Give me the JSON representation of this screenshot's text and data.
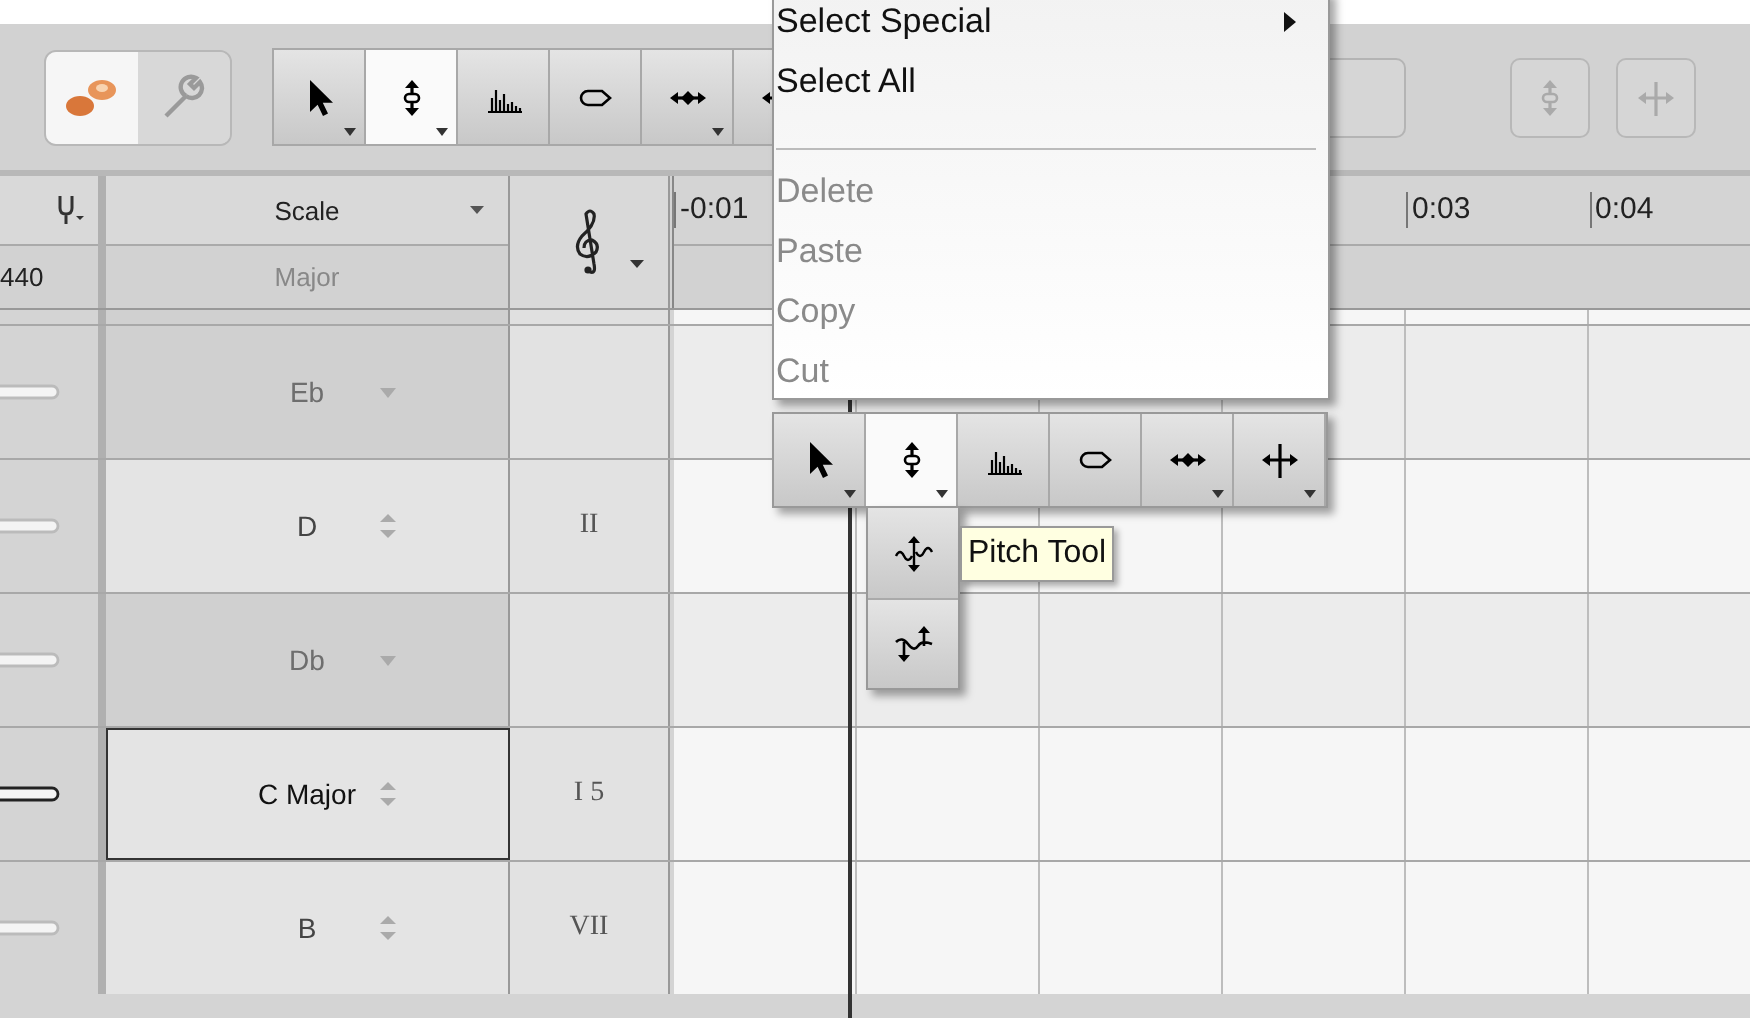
{
  "toolbar": {
    "modes": [
      {
        "selected": true
      },
      {
        "selected": false
      }
    ],
    "tools": [
      {
        "selected": false,
        "has_menu": true
      },
      {
        "selected": true,
        "has_menu": true
      },
      {
        "selected": false,
        "has_menu": false
      },
      {
        "selected": false,
        "has_menu": false
      },
      {
        "selected": false,
        "has_menu": true
      },
      {
        "selected": false
      }
    ]
  },
  "tuning": {
    "value": "440"
  },
  "scale_header": {
    "label": "Scale",
    "value": "Major"
  },
  "timeline": {
    "ticks": [
      {
        "label": "-0:01"
      },
      {
        "label": "0:03"
      },
      {
        "label": "0:04"
      }
    ]
  },
  "rows": [
    {
      "scale": "Eb",
      "enabled": false,
      "selected": false
    },
    {
      "scale": "D",
      "degree": "II",
      "enabled": true,
      "selected": false
    },
    {
      "scale": "Db",
      "enabled": false,
      "selected": false
    },
    {
      "scale": "C Major",
      "degree": "I 5",
      "enabled": true,
      "selected": true
    },
    {
      "scale": "B",
      "degree": "VII",
      "enabled": true,
      "selected": false
    }
  ],
  "context_menu": {
    "items": [
      {
        "kind": "item",
        "label": "Select Special",
        "submenu": true,
        "disabled": false
      },
      {
        "kind": "item",
        "label": "Select All",
        "submenu": false,
        "disabled": false
      },
      {
        "kind": "separator"
      },
      {
        "kind": "item",
        "label": "Delete",
        "submenu": false,
        "disabled": true
      },
      {
        "kind": "item",
        "label": "Paste",
        "submenu": false,
        "disabled": true
      },
      {
        "kind": "item",
        "label": "Copy",
        "submenu": false,
        "disabled": true
      },
      {
        "kind": "item",
        "label": "Cut",
        "submenu": false,
        "disabled": true
      }
    ]
  },
  "floating_toolbar": {
    "tools": [
      {
        "selected": false,
        "has_menu": true
      },
      {
        "selected": true,
        "has_menu": true
      },
      {
        "selected": false,
        "has_menu": false
      },
      {
        "selected": false,
        "has_menu": false
      },
      {
        "selected": false,
        "has_menu": true
      },
      {
        "selected": false,
        "has_menu": true
      }
    ]
  },
  "tooltip": {
    "text": "Pitch Tool"
  }
}
